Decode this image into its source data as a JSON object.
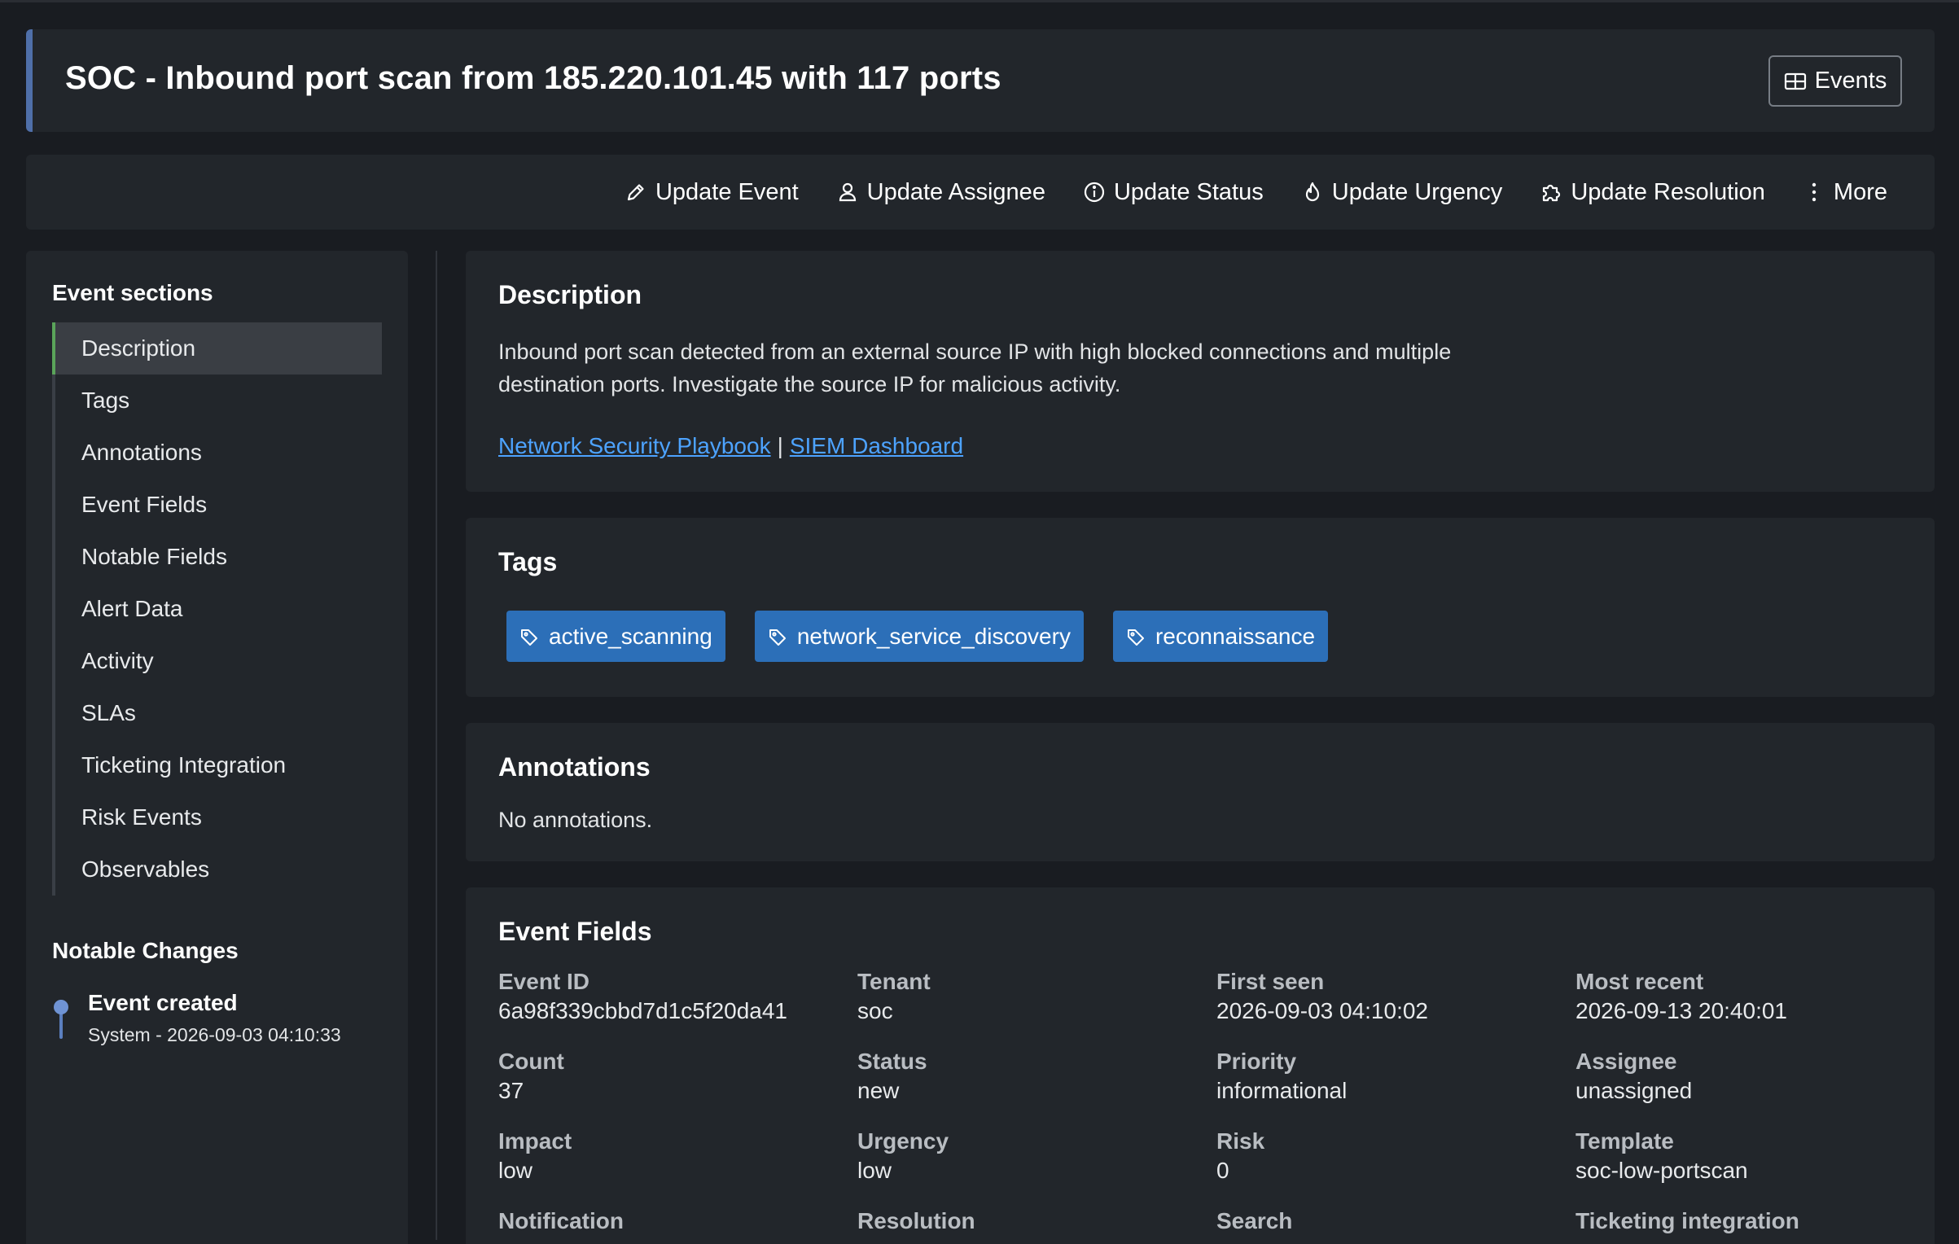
{
  "header": {
    "title": "SOC - Inbound port scan from 185.220.101.45 with 117 ports",
    "events_button": "Events"
  },
  "actions": [
    {
      "label": "Update Event",
      "icon": "pencil-icon"
    },
    {
      "label": "Update Assignee",
      "icon": "user-icon"
    },
    {
      "label": "Update Status",
      "icon": "info-icon"
    },
    {
      "label": "Update Urgency",
      "icon": "flame-icon"
    },
    {
      "label": "Update Resolution",
      "icon": "puzzle-icon"
    },
    {
      "label": "More",
      "icon": "kebab-icon"
    }
  ],
  "sidebar": {
    "sections_heading": "Event sections",
    "items": [
      {
        "label": "Description",
        "active": true
      },
      {
        "label": "Tags"
      },
      {
        "label": "Annotations"
      },
      {
        "label": "Event Fields"
      },
      {
        "label": "Notable Fields"
      },
      {
        "label": "Alert Data"
      },
      {
        "label": "Activity"
      },
      {
        "label": "SLAs"
      },
      {
        "label": "Ticketing Integration"
      },
      {
        "label": "Risk Events"
      },
      {
        "label": "Observables"
      }
    ],
    "changes_heading": "Notable Changes",
    "changes": [
      {
        "title": "Event created",
        "subtitle": "System - 2026-09-03 04:10:33"
      }
    ]
  },
  "description": {
    "heading": "Description",
    "text": "Inbound port scan detected from an external source IP with high blocked connections and multiple destination ports. Investigate the source IP for malicious activity.",
    "links": [
      "Network Security Playbook",
      "SIEM Dashboard"
    ],
    "separator": "|"
  },
  "tags": {
    "heading": "Tags",
    "items": [
      "active_scanning",
      "network_service_discovery",
      "reconnaissance"
    ]
  },
  "annotations": {
    "heading": "Annotations",
    "empty_text": "No annotations."
  },
  "event_fields": {
    "heading": "Event Fields",
    "fields": [
      {
        "label": "Event ID",
        "value": "6a98f339cbbd7d1c5f20da41"
      },
      {
        "label": "Tenant",
        "value": "soc"
      },
      {
        "label": "First seen",
        "value": "2026-09-03 04:10:02"
      },
      {
        "label": "Most recent",
        "value": "2026-09-13 20:40:01"
      },
      {
        "label": "Count",
        "value": "37"
      },
      {
        "label": "Status",
        "value": "new"
      },
      {
        "label": "Priority",
        "value": "informational"
      },
      {
        "label": "Assignee",
        "value": "unassigned"
      },
      {
        "label": "Impact",
        "value": "low"
      },
      {
        "label": "Urgency",
        "value": "low"
      },
      {
        "label": "Risk",
        "value": "0"
      },
      {
        "label": "Template",
        "value": "soc-low-portscan"
      },
      {
        "label": "Notification",
        "value": ""
      },
      {
        "label": "Resolution",
        "value": ""
      },
      {
        "label": "Search",
        "value": ""
      },
      {
        "label": "Ticketing integration",
        "value": ""
      }
    ]
  },
  "colors": {
    "accent": "#4f6fa9",
    "tag": "#2c6fb8",
    "link": "#4da3ff",
    "active_marker": "#5aa45a"
  }
}
